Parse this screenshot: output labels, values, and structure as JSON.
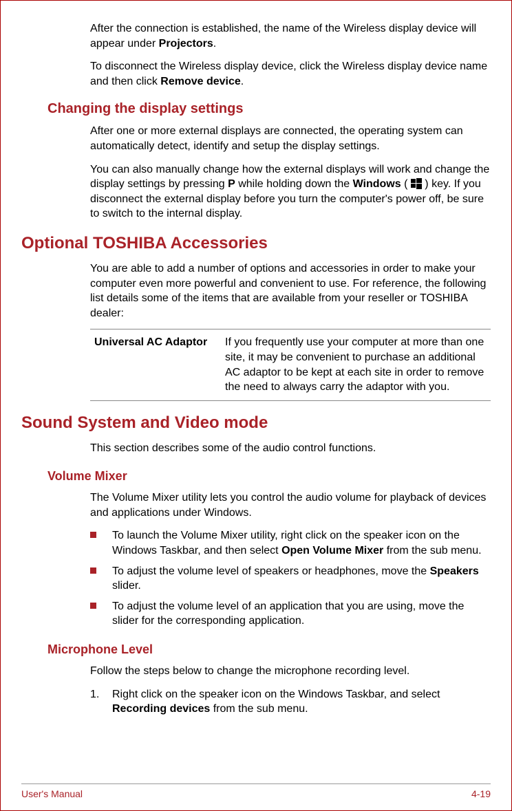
{
  "intro": {
    "p1_a": "After the connection is established, the name of the Wireless display device will appear under ",
    "p1_bold": "Projectors",
    "p1_b": ".",
    "p2_a": "To disconnect the Wireless display device, click the Wireless display device name and then click ",
    "p2_bold": "Remove device",
    "p2_b": "."
  },
  "changing": {
    "heading": "Changing the display settings",
    "p1": "After one or more external displays are connected, the operating system can automatically detect, identify and setup the display settings.",
    "p2_a": "You can also manually change how the external displays will work and change the display settings by pressing ",
    "p2_bold1": "P",
    "p2_b": " while holding down the ",
    "p2_bold2": "Windows",
    "p2_c": " ( ",
    "p2_d": " ) key. If you disconnect the external display before you turn the computer's power off, be sure to switch to the internal display."
  },
  "optional": {
    "heading": "Optional TOSHIBA Accessories",
    "p1": "You are able to add a number of options and accessories in order to make your computer even more powerful and convenient to use. For reference, the following list details some of the items that are available from your reseller or TOSHIBA dealer:",
    "table": {
      "label": "Universal AC Adaptor",
      "desc": "If you frequently use your computer at more than one site, it may be convenient to purchase an additional AC adaptor to be kept at each site in order to remove the need to always carry the adaptor with you."
    }
  },
  "sound": {
    "heading": "Sound System and Video mode",
    "p1": "This section describes some of the audio control functions."
  },
  "volume": {
    "heading": "Volume Mixer",
    "p1": "The Volume Mixer utility lets you control the audio volume for playback of devices and applications under Windows.",
    "b1_a": "To launch the Volume Mixer utility, right click on the speaker icon on the Windows Taskbar, and then select ",
    "b1_bold": "Open Volume Mixer",
    "b1_b": " from the sub menu.",
    "b2_a": "To adjust the volume level of speakers or headphones, move the ",
    "b2_bold": "Speakers",
    "b2_b": " slider.",
    "b3": "To adjust the volume level of an application that you are using, move the slider for the corresponding application."
  },
  "mic": {
    "heading": "Microphone Level",
    "p1": "Follow the steps below to change the microphone recording level.",
    "s1_a": "Right click on the speaker icon on the Windows Taskbar, and select ",
    "s1_bold": "Recording devices",
    "s1_b": " from the sub menu."
  },
  "footer": {
    "left": "User's Manual",
    "right": "4-19"
  }
}
